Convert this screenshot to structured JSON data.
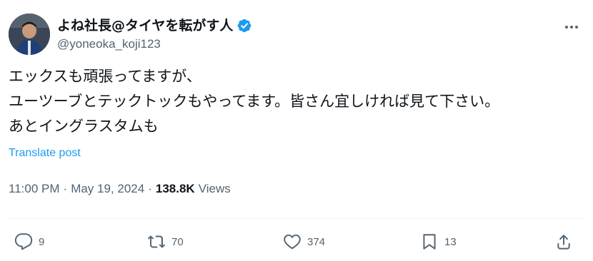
{
  "author": {
    "display_name": "よね社長@タイヤを転がす人",
    "handle": "@yoneoka_koji123",
    "verified_icon": "verified-badge-icon"
  },
  "post": {
    "lines": [
      "エックスも頑張ってますが、",
      "ユーツーブとテックトックもやってます。皆さん宜しければ見て下さい。",
      "あとイングラスタムも"
    ],
    "translate_label": "Translate post"
  },
  "meta": {
    "time": "11:00 PM",
    "date": "May 19, 2024",
    "separator": "·",
    "views_count": "138.8K",
    "views_label": "Views"
  },
  "actions": {
    "replies": "9",
    "reposts": "70",
    "likes": "374",
    "bookmarks": "13"
  },
  "colors": {
    "text": "#0f1419",
    "secondary": "#536471",
    "link": "#1d9bf0",
    "verified": "#1d9bf0"
  }
}
